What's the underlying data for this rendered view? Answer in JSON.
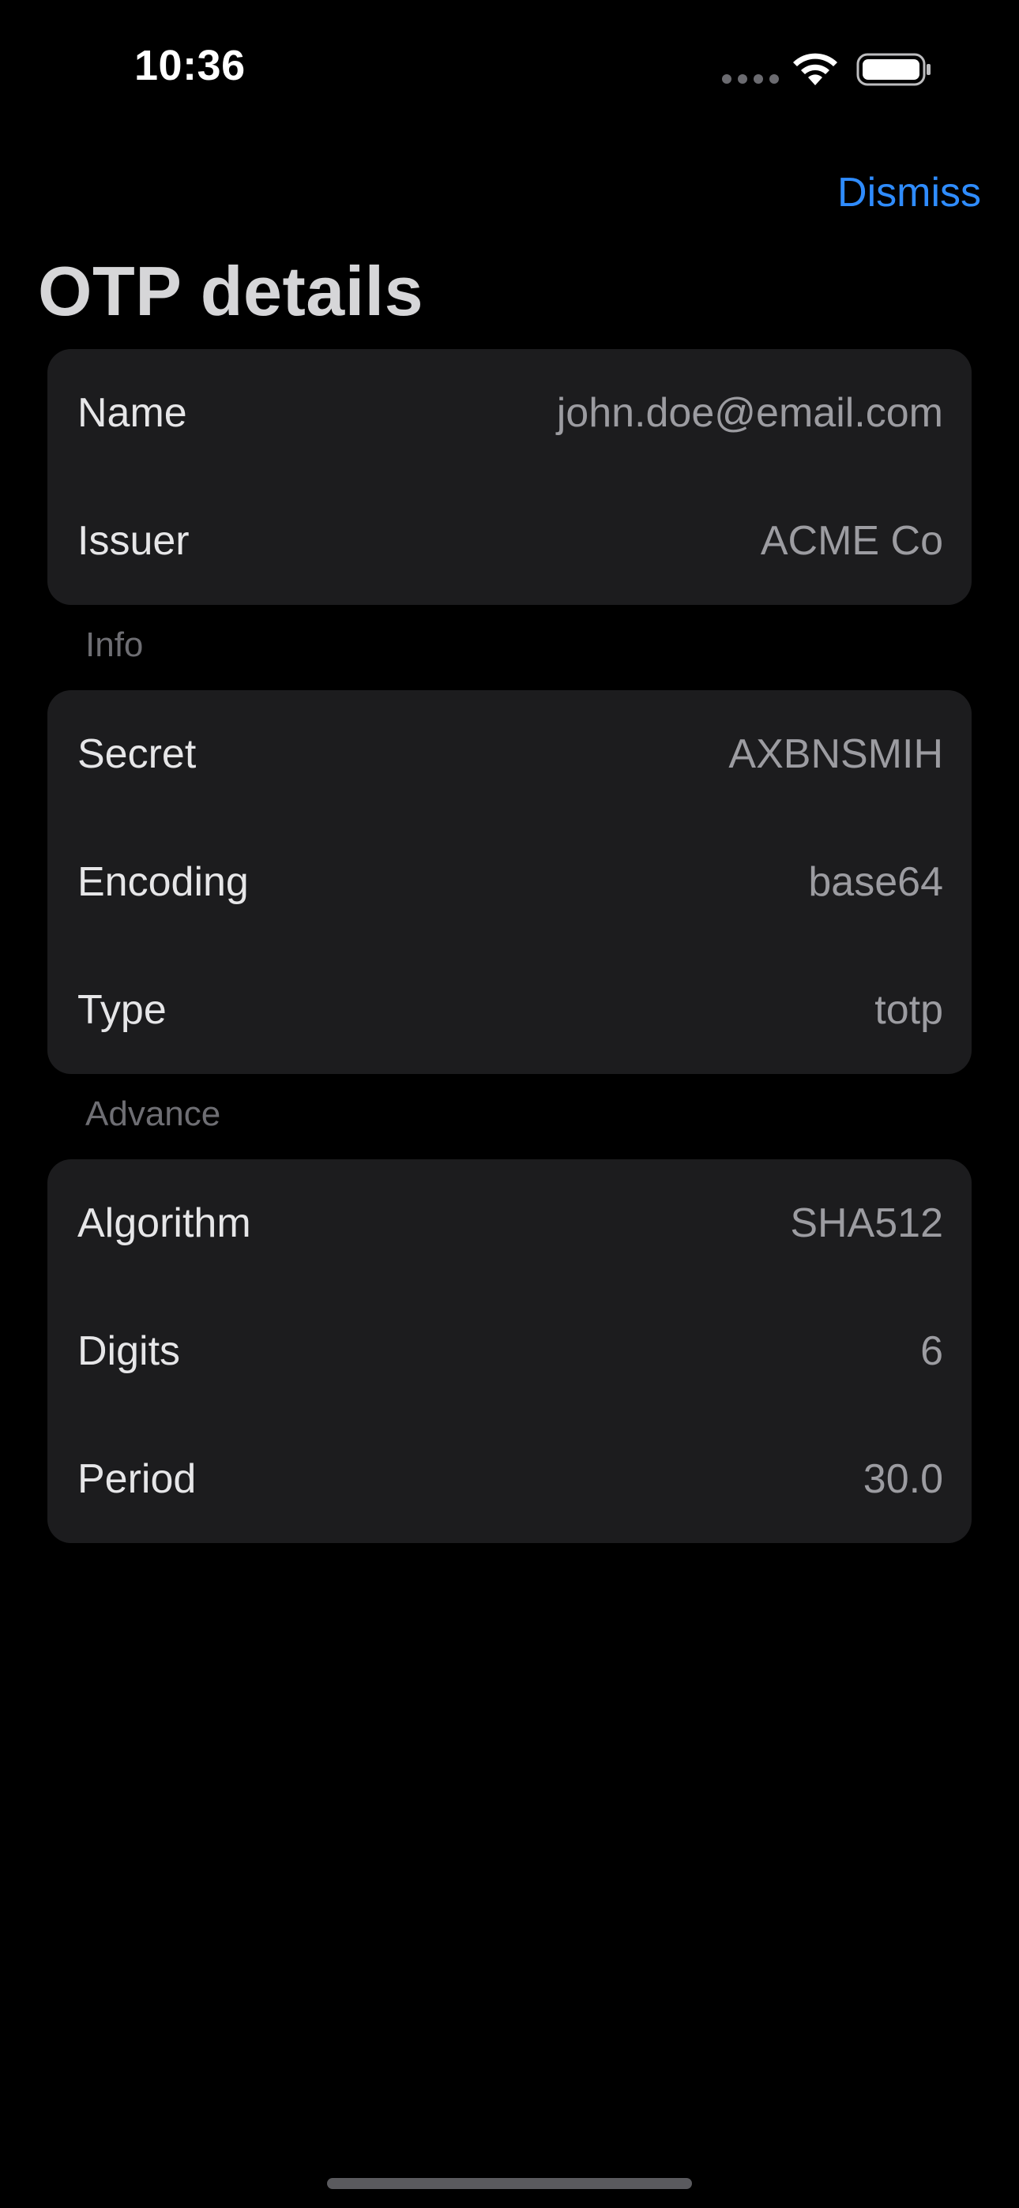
{
  "status_bar": {
    "time": "10:36"
  },
  "nav": {
    "dismiss_label": "Dismiss",
    "title": "OTP details"
  },
  "identity": [
    {
      "label": "Name",
      "value": "john.doe@email.com"
    },
    {
      "label": "Issuer",
      "value": "ACME Co"
    }
  ],
  "info": {
    "header": "Info",
    "rows": [
      {
        "label": "Secret",
        "value": "AXBNSMIH"
      },
      {
        "label": "Encoding",
        "value": "base64"
      },
      {
        "label": "Type",
        "value": "totp"
      }
    ]
  },
  "advance": {
    "header": "Advance",
    "rows": [
      {
        "label": "Algorithm",
        "value": "SHA512"
      },
      {
        "label": "Digits",
        "value": "6"
      },
      {
        "label": "Period",
        "value": "30.0"
      }
    ]
  },
  "colors": {
    "background": "#000000",
    "card": "#1c1c1e",
    "accent": "#2f8cff",
    "label": "#e6e6e8",
    "value": "#9c9ca1",
    "section_header": "#6e6e73"
  },
  "icons": {
    "cellular": "cellular-signal-icon",
    "wifi": "wifi-icon",
    "battery": "battery-icon"
  }
}
